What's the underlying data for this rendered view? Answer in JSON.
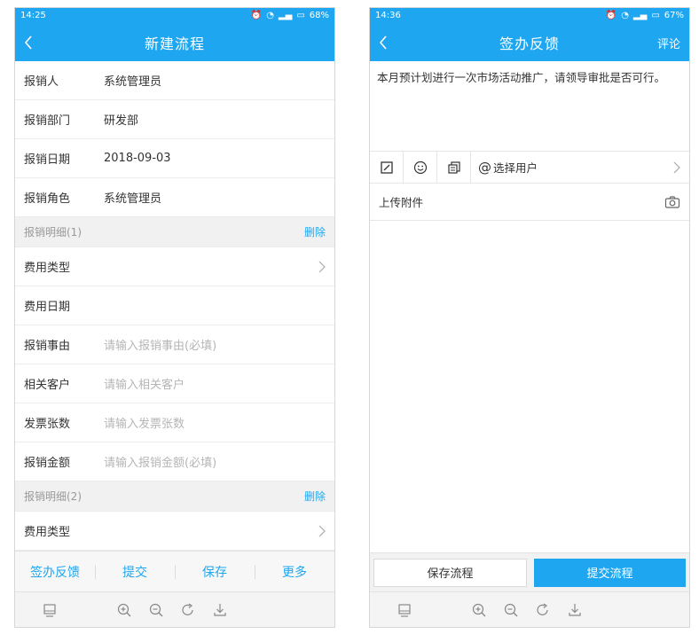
{
  "left": {
    "status": {
      "time": "14:25",
      "battery": "68%"
    },
    "title": "新建流程",
    "fields": [
      {
        "label": "报销人",
        "value": "系统管理员"
      },
      {
        "label": "报销部门",
        "value": "研发部"
      },
      {
        "label": "报销日期",
        "value": "2018-09-03"
      },
      {
        "label": "报销角色",
        "value": "系统管理员"
      }
    ],
    "section1": {
      "title": "报销明细(1)",
      "delete": "删除"
    },
    "detail1": {
      "expense_type": "费用类型",
      "expense_date": "费用日期",
      "reason_label": "报销事由",
      "reason_placeholder": "请输入报销事由(必填)",
      "customer_label": "相关客户",
      "customer_placeholder": "请输入相关客户",
      "invoice_label": "发票张数",
      "invoice_placeholder": "请输入发票张数",
      "amount_label": "报销金额",
      "amount_placeholder": "请输入报销金额(必填)"
    },
    "section2": {
      "title": "报销明细(2)",
      "delete": "删除"
    },
    "detail2": {
      "expense_type": "费用类型"
    },
    "actions": [
      "签办反馈",
      "提交",
      "保存",
      "更多"
    ]
  },
  "right": {
    "status": {
      "time": "14:36",
      "battery": "67%"
    },
    "title": "签办反馈",
    "nav_right": "评论",
    "feedback_text": "本月预计划进行一次市场活动推广，请领导审批是否可行。",
    "select_user": "选择用户",
    "upload": "上传附件",
    "save_button": "保存流程",
    "submit_button": "提交流程"
  },
  "toolbar_icons": [
    "monitor-icon",
    "zoom-in-icon",
    "zoom-out-icon",
    "rotate-icon",
    "download-icon"
  ],
  "colors": {
    "accent": "#1ea7f0"
  }
}
